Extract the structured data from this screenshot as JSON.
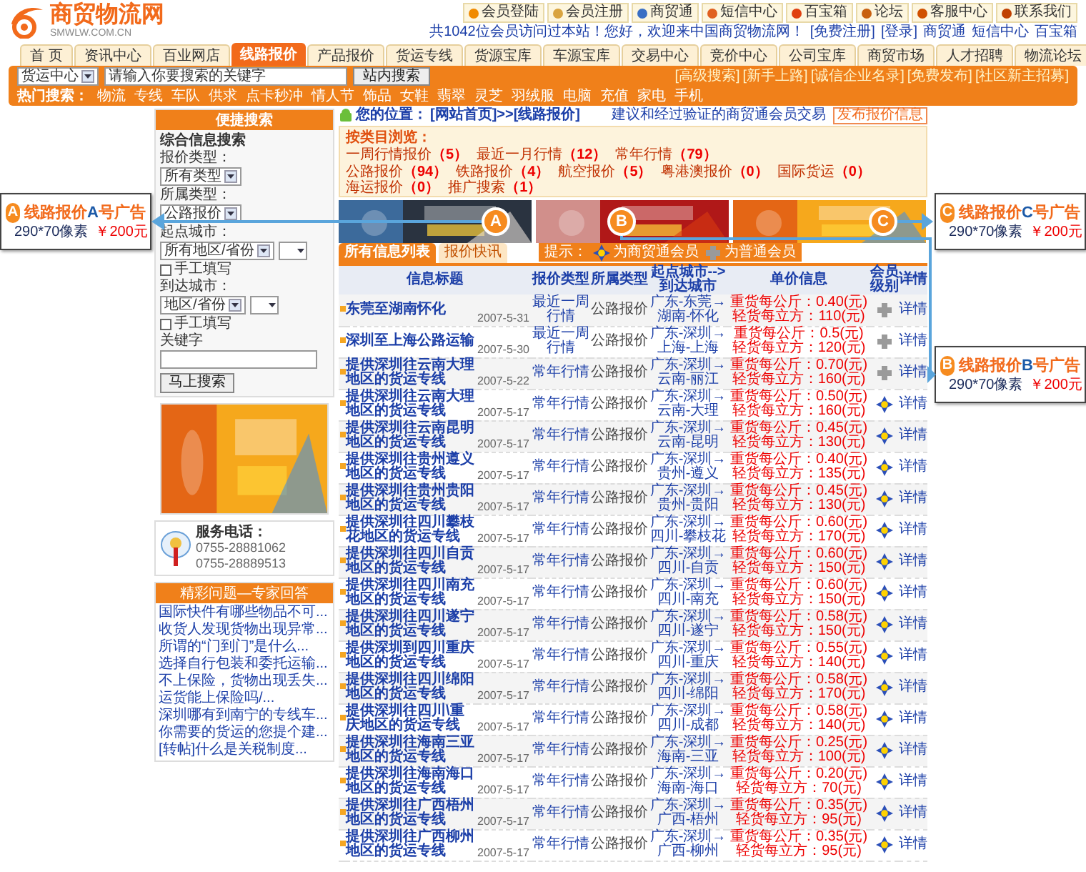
{
  "logo": {
    "name": "商贸物流网",
    "domain": "SMWLW.COM.CN"
  },
  "top_links": [
    "会员登陆",
    "会员注册",
    "商贸通",
    "短信中心",
    "百宝箱",
    "论坛",
    "客服中心",
    "联系我们"
  ],
  "welcome": {
    "text": "共1042位会员访问过本站！您好，欢迎来中国商贸物流网！",
    "links": [
      "[免费注册]",
      "[登录]",
      "商贸通",
      "短信中心",
      "百宝箱"
    ]
  },
  "nav_tabs": [
    {
      "label": "首 页",
      "selected": false
    },
    {
      "label": "资讯中心",
      "selected": false
    },
    {
      "label": "百业网店",
      "selected": false
    },
    {
      "label": "线路报价",
      "selected": true
    },
    {
      "label": "产品报价",
      "selected": false
    },
    {
      "label": "货运专线",
      "selected": false
    },
    {
      "label": "货源宝库",
      "selected": false
    },
    {
      "label": "车源宝库",
      "selected": false
    },
    {
      "label": "交易中心",
      "selected": false
    },
    {
      "label": "竞价中心",
      "selected": false
    },
    {
      "label": "公司宝库",
      "selected": false
    },
    {
      "label": "商贸市场",
      "selected": false
    },
    {
      "label": "人才招聘",
      "selected": false
    },
    {
      "label": "物流论坛",
      "selected": false
    }
  ],
  "search": {
    "scope": "货运中心",
    "placeholder": "请输入你要搜索的关键字",
    "button": "站内搜索",
    "links": [
      "[高级搜索]",
      "[新手上路]",
      "[诚信企业名录]",
      "[免费发布]",
      "[社区新主招募]"
    ]
  },
  "hot_search": {
    "label": "热门搜索：",
    "terms": [
      "物流",
      "专线",
      "车队",
      "供求",
      "点卡秒冲",
      "情人节",
      "饰品",
      "女鞋",
      "翡翠",
      "灵芝",
      "羽绒服",
      "电脑",
      "充值",
      "家电",
      "手机"
    ]
  },
  "quick_search": {
    "title": "便捷搜索",
    "subtitle": "综合信息搜索",
    "fields": [
      {
        "kind": "select",
        "label": "报价类型：",
        "value": "所有类型"
      },
      {
        "kind": "select",
        "label": "所属类型：",
        "value": "公路报价"
      },
      {
        "kind": "select2",
        "label": "起点城市：",
        "value": "所有地区/省份"
      },
      {
        "kind": "check",
        "label": "手工填写",
        "checked": false
      },
      {
        "kind": "select2",
        "label": "到达城市：",
        "value": "地区/省份"
      },
      {
        "kind": "check",
        "label": "手工填写",
        "checked": false
      },
      {
        "kind": "input",
        "label": "关键字"
      }
    ],
    "button": "马上搜索"
  },
  "service": {
    "title": "服务电话：",
    "phones": [
      "0755-28881062",
      "0755-28889513"
    ]
  },
  "qa": {
    "title": "精彩问题—专家回答",
    "items": [
      "国际快件有哪些物品不可...",
      "收货人发现货物出现异常...",
      "所谓的“门到门”是什么...",
      "选择自行包装和委托运输...",
      "不上保险，货物出现丢失...",
      "运货能上保险吗/...",
      "深圳哪有到南宁的专线车...",
      "你需要的货运的您提个建...",
      "[转帖]什么是关税制度..."
    ]
  },
  "breadcrumb": {
    "label": "您的位置：",
    "path": "[网站首页]>>[线路报价]",
    "note": "建议和经过验证的商贸通会员交易",
    "button": "发布报价信息"
  },
  "filters": {
    "title": "按类目浏览：",
    "rows": [
      [
        {
          "label": "一周行情报价",
          "count": "（5）"
        },
        {
          "label": "最近一月行情",
          "count": "（12）"
        },
        {
          "label": "常年行情",
          "count": "（79）"
        }
      ],
      [
        {
          "label": "公路报价",
          "count": "（94）"
        },
        {
          "label": "铁路报价",
          "count": "（4）"
        },
        {
          "label": "航空报价",
          "count": "（5）"
        },
        {
          "label": "粤港澳报价",
          "count": "（0）"
        },
        {
          "label": "国际货运",
          "count": "（0）"
        },
        {
          "label": "海运报价",
          "count": "（0）"
        },
        {
          "label": "推广搜索",
          "count": "（1）"
        }
      ]
    ]
  },
  "banners": [
    {
      "kind": "picture",
      "marker": "A"
    },
    {
      "kind": "picture",
      "marker": "B"
    },
    {
      "kind": "picture",
      "marker": "C"
    }
  ],
  "left_callouts": [
    {
      "marker": "A",
      "title_before": "线路报价",
      "letter": "A",
      "title_after": "号广告",
      "size": "290*70像素",
      "price": "￥200元"
    }
  ],
  "right_callouts": [
    {
      "marker": "C",
      "title_before": "线路报价",
      "letter": "C",
      "title_after": "号广告",
      "size": "290*70像素",
      "price": "￥200元"
    },
    {
      "marker": "B",
      "title_before": "线路报价",
      "letter": "B",
      "title_after": "号广告",
      "size": "290*70像素",
      "price": "￥200元"
    }
  ],
  "list_tabs": [
    {
      "label": "所有信息列表",
      "selected": true
    },
    {
      "label": "报价快讯",
      "selected": false
    }
  ],
  "legend": {
    "label": "提示：",
    "items": [
      {
        "kind": "vip",
        "label": "为商贸通会员"
      },
      {
        "kind": "normal",
        "label": "为普通会员"
      }
    ]
  },
  "table": {
    "columns": [
      "信息标题",
      "报价类型",
      "所属类型",
      "起点城市-->到达城市",
      "单价信息",
      "会员级别",
      "详情"
    ],
    "rows": [
      {
        "title": "东莞至湖南怀化",
        "date": "2007-5-31",
        "type": "最近一周行情",
        "category": "公路报价",
        "route": "广东-东莞→湖南-怀化",
        "heavy": "重货每公斤：0.40(元)",
        "light": "轻货每立方：110(元)",
        "kind": "normal",
        "detail": "详情"
      },
      {
        "title": "深圳至上海公路运输",
        "date": "2007-5-30",
        "type": "最近一周行情",
        "category": "公路报价",
        "route": "广东-深圳→上海-上海",
        "heavy": "重货每公斤：0.5(元)",
        "light": "轻货每立方：120(元)",
        "kind": "normal",
        "detail": "详情"
      },
      {
        "title": "提供深圳往云南大理地区的货运专线",
        "date": "2007-5-22",
        "type": "常年行情",
        "category": "公路报价",
        "route": "广东-深圳→云南-丽江",
        "heavy": "重货每公斤：0.70(元)",
        "light": "轻货每立方：160(元)",
        "kind": "normal",
        "detail": "详情"
      },
      {
        "title": "提供深圳往云南大理地区的货运专线",
        "date": "2007-5-17",
        "type": "常年行情",
        "category": "公路报价",
        "route": "广东-深圳→云南-大理",
        "heavy": "重货每公斤：0.50(元)",
        "light": "轻货每立方：160(元)",
        "kind": "vip",
        "detail": "详情"
      },
      {
        "title": "提供深圳往云南昆明地区的货运专线",
        "date": "2007-5-17",
        "type": "常年行情",
        "category": "公路报价",
        "route": "广东-深圳→云南-昆明",
        "heavy": "重货每公斤：0.45(元)",
        "light": "轻货每立方：130(元)",
        "kind": "vip",
        "detail": "详情"
      },
      {
        "title": "提供深圳往贵州遵义地区的货运专线",
        "date": "2007-5-17",
        "type": "常年行情",
        "category": "公路报价",
        "route": "广东-深圳→贵州-遵义",
        "heavy": "重货每公斤：0.40(元)",
        "light": "轻货每立方：135(元)",
        "kind": "vip",
        "detail": "详情"
      },
      {
        "title": "提供深圳往贵州贵阳地区的货运专线",
        "date": "2007-5-17",
        "type": "常年行情",
        "category": "公路报价",
        "route": "广东-深圳→贵州-贵阳",
        "heavy": "重货每公斤：0.45(元)",
        "light": "轻货每立方：130(元)",
        "kind": "vip",
        "detail": "详情"
      },
      {
        "title": "提供深圳往四川攀枝花地区的货运专线",
        "date": "2007-5-17",
        "type": "常年行情",
        "category": "公路报价",
        "route": "广东-深圳→四川-攀枝花",
        "heavy": "重货每公斤：0.60(元)",
        "light": "轻货每立方：170(元)",
        "kind": "vip",
        "detail": "详情"
      },
      {
        "title": "提供深圳往四川自贡地区的货运专线",
        "date": "2007-5-17",
        "type": "常年行情",
        "category": "公路报价",
        "route": "广东-深圳→四川-自贡",
        "heavy": "重货每公斤：0.60(元)",
        "light": "轻货每立方：150(元)",
        "kind": "vip",
        "detail": "详情"
      },
      {
        "title": "提供深圳往四川南充地区的货运专线",
        "date": "2007-5-17",
        "type": "常年行情",
        "category": "公路报价",
        "route": "广东-深圳→四川-南充",
        "heavy": "重货每公斤：0.60(元)",
        "light": "轻货每立方：150(元)",
        "kind": "vip",
        "detail": "详情"
      },
      {
        "title": "提供深圳往四川遂宁地区的货运专线",
        "date": "2007-5-17",
        "type": "常年行情",
        "category": "公路报价",
        "route": "广东-深圳→四川-遂宁",
        "heavy": "重货每公斤：0.58(元)",
        "light": "轻货每立方：150(元)",
        "kind": "vip",
        "detail": "详情"
      },
      {
        "title": "提供深圳到四川重庆地区的货运专线",
        "date": "2007-5-17",
        "type": "常年行情",
        "category": "公路报价",
        "route": "广东-深圳→四川-重庆",
        "heavy": "重货每公斤：0.55(元)",
        "light": "轻货每立方：140(元)",
        "kind": "vip",
        "detail": "详情"
      },
      {
        "title": "提供深圳往四川绵阳地区的货运专线",
        "date": "2007-5-17",
        "type": "常年行情",
        "category": "公路报价",
        "route": "广东-深圳→四川-绵阳",
        "heavy": "重货每公斤：0.58(元)",
        "light": "轻货每立方：170(元)",
        "kind": "vip",
        "detail": "详情"
      },
      {
        "title": "提供深圳往四川\\重庆地区的货运专线",
        "date": "2007-5-17",
        "type": "常年行情",
        "category": "公路报价",
        "route": "广东-深圳→四川-成都",
        "heavy": "重货每公斤：0.58(元)",
        "light": "轻货每立方：140(元)",
        "kind": "vip",
        "detail": "详情"
      },
      {
        "title": "提供深圳往海南三亚地区的货运专线",
        "date": "2007-5-17",
        "type": "常年行情",
        "category": "公路报价",
        "route": "广东-深圳→海南-三亚",
        "heavy": "重货每公斤：0.25(元)",
        "light": "轻货每立方：100(元)",
        "kind": "vip",
        "detail": "详情"
      },
      {
        "title": "提供深圳往海南海口地区的货运专线",
        "date": "2007-5-17",
        "type": "常年行情",
        "category": "公路报价",
        "route": "广东-深圳→海南-海口",
        "heavy": "重货每公斤：0.20(元)",
        "light": "轻货每立方：70(元)",
        "kind": "vip",
        "detail": "详情"
      },
      {
        "title": "提供深圳往广西梧州地区的货运专线",
        "date": "2007-5-17",
        "type": "常年行情",
        "category": "公路报价",
        "route": "广东-深圳→广西-梧州",
        "heavy": "重货每公斤：0.35(元)",
        "light": "轻货每立方：95(元)",
        "kind": "vip",
        "detail": "详情"
      },
      {
        "title": "提供深圳往广西柳州地区的货运专线",
        "date": "2007-5-17",
        "type": "常年行情",
        "category": "公路报价",
        "route": "广东-深圳→广西-柳州",
        "heavy": "重货每公斤：0.35(元)",
        "light": "轻货每立方：95(元)",
        "kind": "vip",
        "detail": "详情"
      }
    ]
  }
}
